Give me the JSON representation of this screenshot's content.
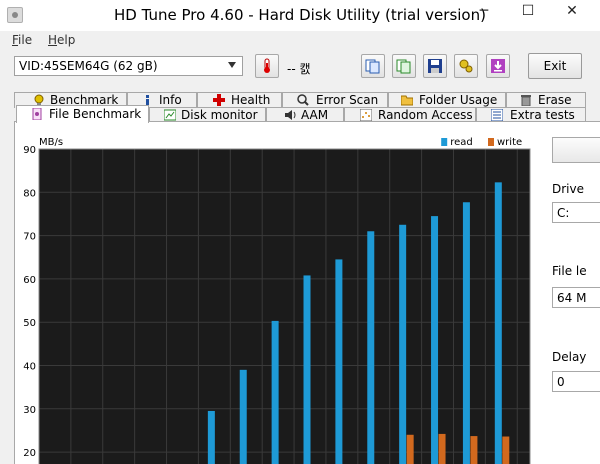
{
  "window": {
    "title": "HD Tune Pro 4.60 - Hard Disk Utility (trial version)"
  },
  "window_buttons": {
    "minimize": "─",
    "maximize": "☐",
    "close": "✕"
  },
  "menu": [
    {
      "key": "F",
      "rest": "ile"
    },
    {
      "key": "H",
      "rest": "elp"
    }
  ],
  "toolbar": {
    "drive": "VID:45SEM64G (62 gB)",
    "temperature": "-- 캜",
    "buttons": [
      "copy-info",
      "copy-screenshot",
      "save",
      "options",
      "download"
    ],
    "exit_label": "Exit"
  },
  "tabs_top": [
    "Benchmark",
    "Info",
    "Health",
    "Error Scan",
    "Folder Usage",
    "Erase"
  ],
  "tabs_bottom": [
    "File Benchmark",
    "Disk monitor",
    "AAM",
    "Random Access",
    "Extra tests"
  ],
  "active_tab": "File Benchmark",
  "right_panel": {
    "drive_label": "Drive",
    "drive_value": "C:",
    "file_length_label": "File le",
    "file_length_value": "64 M",
    "delay_label": "Delay",
    "delay_value": "0"
  },
  "chart_data": {
    "type": "bar",
    "ylabel": "MB/s",
    "ylim": [
      20,
      90
    ],
    "yticks": [
      90,
      80,
      70,
      60,
      50,
      40,
      30,
      20
    ],
    "grid": true,
    "legend": "top-right",
    "series": [
      {
        "name": "read",
        "color": "#1e9ad6",
        "values": [
          null,
          null,
          null,
          null,
          null,
          29.5,
          39,
          50.3,
          60.8,
          64.5,
          71,
          72.5,
          74.5,
          77.7,
          82.3
        ]
      },
      {
        "name": "write",
        "color": "#d2691e",
        "values": [
          null,
          null,
          null,
          null,
          null,
          null,
          null,
          null,
          null,
          null,
          null,
          24,
          24.2,
          23.7,
          23.6
        ]
      }
    ]
  }
}
